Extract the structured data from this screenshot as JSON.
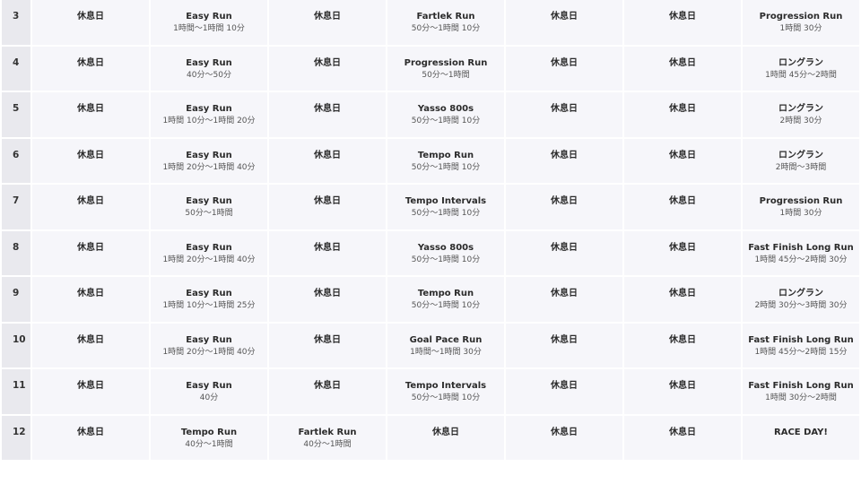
{
  "plan": {
    "rows": [
      {
        "week": "3",
        "days": [
          {
            "title": "休息日",
            "detail": ""
          },
          {
            "title": "Easy Run",
            "detail": "1時間〜1時間 10分"
          },
          {
            "title": "休息日",
            "detail": ""
          },
          {
            "title": "Fartlek Run",
            "detail": "50分〜1時間 10分"
          },
          {
            "title": "休息日",
            "detail": ""
          },
          {
            "title": "休息日",
            "detail": ""
          },
          {
            "title": "Progression Run",
            "detail": "1時間 30分"
          }
        ]
      },
      {
        "week": "4",
        "days": [
          {
            "title": "休息日",
            "detail": ""
          },
          {
            "title": "Easy Run",
            "detail": "40分〜50分"
          },
          {
            "title": "休息日",
            "detail": ""
          },
          {
            "title": "Progression Run",
            "detail": "50分〜1時間"
          },
          {
            "title": "休息日",
            "detail": ""
          },
          {
            "title": "休息日",
            "detail": ""
          },
          {
            "title": "ロングラン",
            "detail": "1時間 45分〜2時間"
          }
        ]
      },
      {
        "week": "5",
        "days": [
          {
            "title": "休息日",
            "detail": ""
          },
          {
            "title": "Easy Run",
            "detail": "1時間 10分〜1時間 20分"
          },
          {
            "title": "休息日",
            "detail": ""
          },
          {
            "title": "Yasso 800s",
            "detail": "50分〜1時間 10分"
          },
          {
            "title": "休息日",
            "detail": ""
          },
          {
            "title": "休息日",
            "detail": ""
          },
          {
            "title": "ロングラン",
            "detail": "2時間 30分"
          }
        ]
      },
      {
        "week": "6",
        "days": [
          {
            "title": "休息日",
            "detail": ""
          },
          {
            "title": "Easy Run",
            "detail": "1時間 20分〜1時間 40分"
          },
          {
            "title": "休息日",
            "detail": ""
          },
          {
            "title": "Tempo Run",
            "detail": "50分〜1時間 10分"
          },
          {
            "title": "休息日",
            "detail": ""
          },
          {
            "title": "休息日",
            "detail": ""
          },
          {
            "title": "ロングラン",
            "detail": "2時間〜3時間"
          }
        ]
      },
      {
        "week": "7",
        "days": [
          {
            "title": "休息日",
            "detail": ""
          },
          {
            "title": "Easy Run",
            "detail": "50分〜1時間"
          },
          {
            "title": "休息日",
            "detail": ""
          },
          {
            "title": "Tempo Intervals",
            "detail": "50分〜1時間 10分"
          },
          {
            "title": "休息日",
            "detail": ""
          },
          {
            "title": "休息日",
            "detail": ""
          },
          {
            "title": "Progression Run",
            "detail": "1時間 30分"
          }
        ]
      },
      {
        "week": "8",
        "days": [
          {
            "title": "休息日",
            "detail": ""
          },
          {
            "title": "Easy Run",
            "detail": "1時間 20分〜1時間 40分"
          },
          {
            "title": "休息日",
            "detail": ""
          },
          {
            "title": "Yasso 800s",
            "detail": "50分〜1時間 10分"
          },
          {
            "title": "休息日",
            "detail": ""
          },
          {
            "title": "休息日",
            "detail": ""
          },
          {
            "title": "Fast Finish Long Run",
            "detail": "1時間 45分〜2時間 30分"
          }
        ]
      },
      {
        "week": "9",
        "days": [
          {
            "title": "休息日",
            "detail": ""
          },
          {
            "title": "Easy Run",
            "detail": "1時間 10分〜1時間 25分"
          },
          {
            "title": "休息日",
            "detail": ""
          },
          {
            "title": "Tempo Run",
            "detail": "50分〜1時間 10分"
          },
          {
            "title": "休息日",
            "detail": ""
          },
          {
            "title": "休息日",
            "detail": ""
          },
          {
            "title": "ロングラン",
            "detail": "2時間 30分〜3時間 30分"
          }
        ]
      },
      {
        "week": "10",
        "days": [
          {
            "title": "休息日",
            "detail": ""
          },
          {
            "title": "Easy Run",
            "detail": "1時間 20分〜1時間 40分"
          },
          {
            "title": "休息日",
            "detail": ""
          },
          {
            "title": "Goal Pace Run",
            "detail": "1時間〜1時間 30分"
          },
          {
            "title": "休息日",
            "detail": ""
          },
          {
            "title": "休息日",
            "detail": ""
          },
          {
            "title": "Fast Finish Long Run",
            "detail": "1時間 45分〜2時間 15分"
          }
        ]
      },
      {
        "week": "11",
        "days": [
          {
            "title": "休息日",
            "detail": ""
          },
          {
            "title": "Easy Run",
            "detail": "40分"
          },
          {
            "title": "休息日",
            "detail": ""
          },
          {
            "title": "Tempo Intervals",
            "detail": "50分〜1時間 10分"
          },
          {
            "title": "休息日",
            "detail": ""
          },
          {
            "title": "休息日",
            "detail": ""
          },
          {
            "title": "Fast Finish Long Run",
            "detail": "1時間 30分〜2時間"
          }
        ]
      },
      {
        "week": "12",
        "days": [
          {
            "title": "休息日",
            "detail": ""
          },
          {
            "title": "Tempo Run",
            "detail": "40分〜1時間"
          },
          {
            "title": "Fartlek Run",
            "detail": "40分〜1時間"
          },
          {
            "title": "休息日",
            "detail": ""
          },
          {
            "title": "休息日",
            "detail": ""
          },
          {
            "title": "休息日",
            "detail": ""
          },
          {
            "title": "RACE DAY!",
            "detail": ""
          }
        ]
      }
    ]
  }
}
